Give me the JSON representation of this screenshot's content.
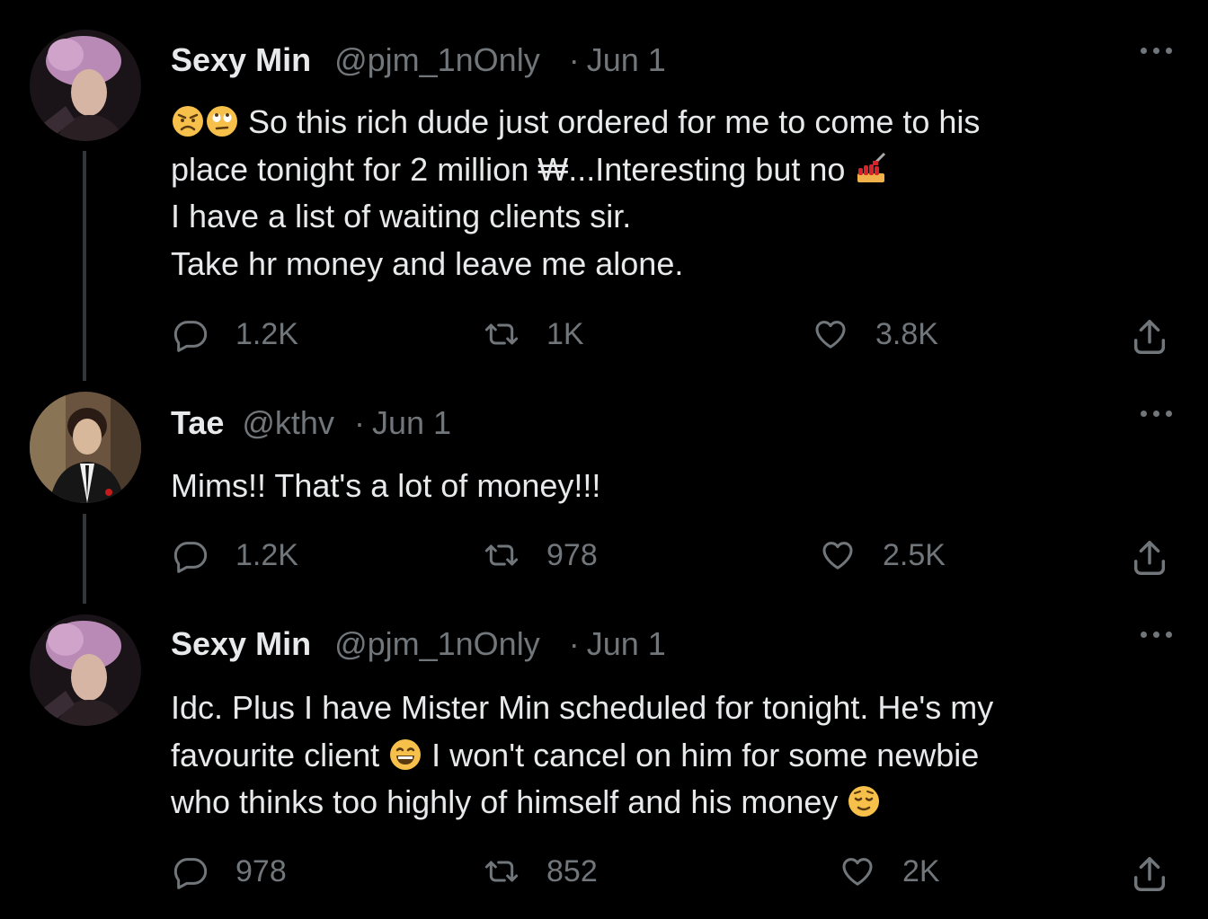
{
  "tweets": [
    {
      "name": "Sexy Min",
      "handle": "@pjm_1nOnly",
      "dot": "·",
      "date": "Jun 1",
      "text": {
        "l1": "So this rich dude just ordered for me to come to his",
        "l2": "place tonight for 2 million ₩...Interesting but no",
        "l3": "I have a list of waiting clients sir.",
        "l4": "Take hr money and leave me alone."
      },
      "emojis": [
        "angry-face-emoji",
        "face-with-rolling-eyes-emoji",
        "nail-polish-emoji"
      ],
      "replies": "1.2K",
      "retweets": "1K",
      "likes": "3.8K"
    },
    {
      "name": "Tae",
      "handle": "@kthv",
      "dot": "·",
      "date": "Jun 1",
      "text": {
        "l1": "Mims!! That's a lot of money!!!"
      },
      "replies": "1.2K",
      "retweets": "978",
      "likes": "2.5K"
    },
    {
      "name": "Sexy Min",
      "handle": "@pjm_1nOnly",
      "dot": "·",
      "date": "Jun 1",
      "text": {
        "l1": "Idc. Plus I have Mister Min scheduled for tonight. He's my",
        "l2a": "favourite client",
        "l2b": "I won't cancel on him for some newbie",
        "l3": "who thinks too highly of himself and his money"
      },
      "emojis": [
        "grinning-face-emoji",
        "relieved-face-emoji"
      ],
      "replies": "978",
      "retweets": "852",
      "likes": "2K"
    }
  ],
  "colors": {
    "background": "#000000",
    "text": "#e7e9ea",
    "muted": "#71767b",
    "thread_line": "#333639"
  }
}
